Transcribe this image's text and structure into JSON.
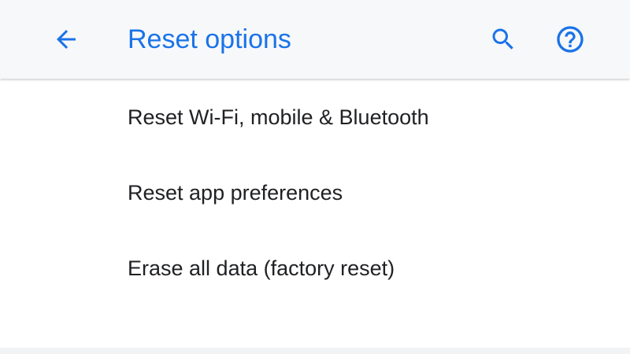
{
  "app_bar": {
    "title": "Reset options",
    "back_icon": "arrow-back-icon",
    "search_icon": "search-icon",
    "help_icon": "help-outline-icon",
    "accent_color": "#1a73e8",
    "background_color": "#f7f8fa"
  },
  "list": {
    "items": [
      {
        "label": "Reset Wi-Fi, mobile & Bluetooth"
      },
      {
        "label": "Reset app preferences"
      },
      {
        "label": "Erase all data (factory reset)"
      }
    ],
    "text_color": "#202124"
  }
}
